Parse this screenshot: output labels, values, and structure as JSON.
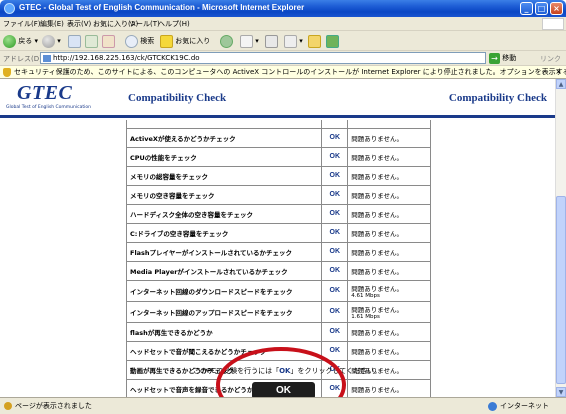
{
  "window": {
    "title": "GTEC - Global Test of English Communication - Microsoft Internet Explorer",
    "controls": [
      "_",
      "□",
      "×"
    ]
  },
  "menu": {
    "items": [
      "ファイル(F)",
      "編集(E)",
      "表示(V)",
      "お気に入り(A)",
      "ツール(T)",
      "ヘルプ(H)"
    ]
  },
  "toolbar": {
    "back_label": "戻る",
    "search_label": "検索",
    "favorites_label": "お気に入り"
  },
  "address": {
    "label": "アドレス(D)",
    "url": "http://192.168.225.163/ck/GTCKCK19C.do",
    "go_label": "移動",
    "links_label": "リンク »"
  },
  "infobar": {
    "text": "セキュリティ保護のため、このサイトによる、このコンピュータへの ActiveX コントロールのインストールが Internet Explorer により停止されました。オプションを表示するには、ここをクリックしてください..."
  },
  "header": {
    "logo": "GTEC",
    "logo_sub": "Global Test of English Communication",
    "title": "Compatibility Check",
    "title_right": "Compatibility Check"
  },
  "checks": [
    {
      "item": "ActiveXが使えるかどうかチェック",
      "status": "OK",
      "result": "問題ありません。",
      "detail": ""
    },
    {
      "item": "CPUの性能をチェック",
      "status": "OK",
      "result": "問題ありません。",
      "detail": ""
    },
    {
      "item": "メモリの総容量をチェック",
      "status": "OK",
      "result": "問題ありません。",
      "detail": ""
    },
    {
      "item": "メモリの空き容量をチェック",
      "status": "OK",
      "result": "問題ありません。",
      "detail": ""
    },
    {
      "item": "ハードディスク全体の空き容量をチェック",
      "status": "OK",
      "result": "問題ありません。",
      "detail": ""
    },
    {
      "item": "C:ドライブの空き容量をチェック",
      "status": "OK",
      "result": "問題ありません。",
      "detail": ""
    },
    {
      "item": "Flashプレイヤーがインストールされているかチェック",
      "status": "OK",
      "result": "問題ありません。",
      "detail": ""
    },
    {
      "item": "Media Playerがインストールされているかチェック",
      "status": "OK",
      "result": "問題ありません。",
      "detail": ""
    },
    {
      "item": "インターネット回線のダウンロードスピードをチェック",
      "status": "OK",
      "result": "問題ありません。",
      "detail": "4.61 Mbps"
    },
    {
      "item": "インターネット回線のアップロードスピードをチェック",
      "status": "OK",
      "result": "問題ありません。",
      "detail": "1.61 Mbps"
    },
    {
      "item": "flashが再生できるかどうか",
      "status": "OK",
      "result": "問題ありません。",
      "detail": ""
    },
    {
      "item": "ヘッドセットで音が聞こえるかどうかチェック",
      "status": "OK",
      "result": "問題ありません。",
      "detail": ""
    },
    {
      "item": "動画が再生できるかどうかチェック",
      "status": "OK",
      "result": "問題ありません。",
      "detail": ""
    },
    {
      "item": "ヘッドセットで音声を録音できるかどうかチェック",
      "status": "OK",
      "result": "問題ありません。",
      "detail": ""
    }
  ],
  "instruction": {
    "before": "このPCで",
    "mid": "受験を行うには「",
    "highlight": "OK",
    "after": "」をクリックしてください。"
  },
  "ok_button": "OK",
  "status": {
    "text": "ページが表示されました",
    "zone": "インターネット"
  },
  "colors": {
    "accent": "#1a3a8a",
    "annotation": "#c8101a"
  }
}
